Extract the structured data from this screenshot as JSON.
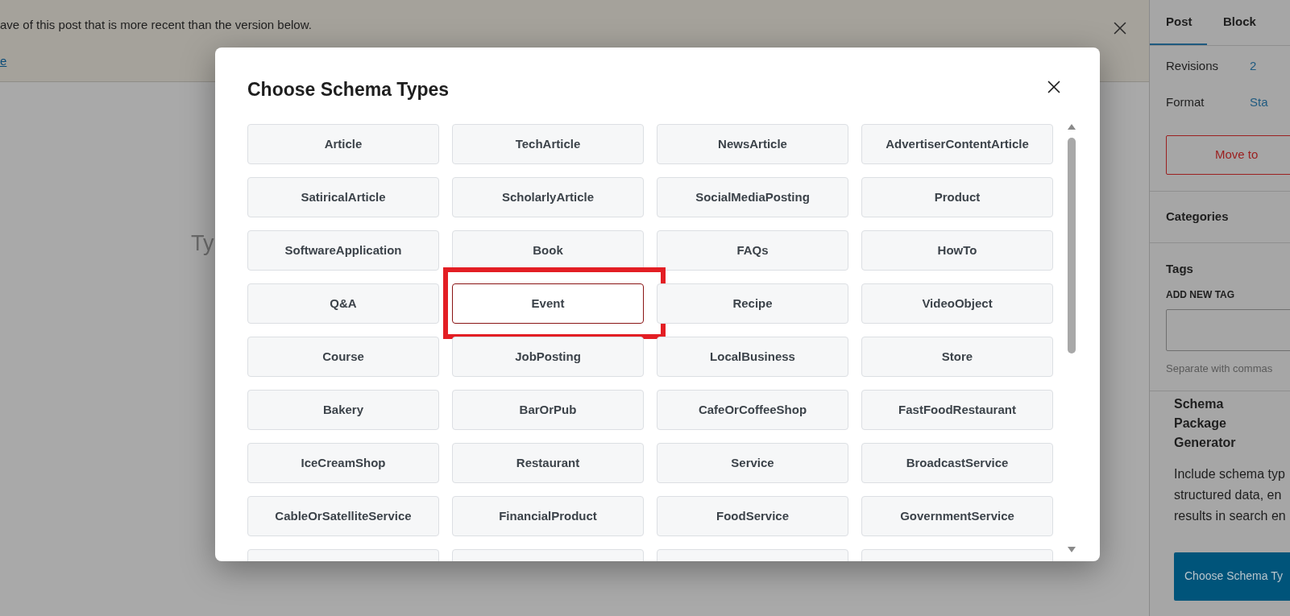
{
  "notice": {
    "message": "ave of this post that is more recent than the version below.",
    "link": "e"
  },
  "editor": {
    "placeholder": "Ty"
  },
  "sidebar": {
    "tabs": [
      {
        "label": "Post",
        "selected": true
      },
      {
        "label": "Block",
        "selected": false
      }
    ],
    "rows": [
      {
        "label": "Revisions",
        "value": "2"
      },
      {
        "label": "Format",
        "value": "Sta"
      }
    ],
    "trash_button": "Move to",
    "sections": [
      "Categories",
      "Tags"
    ],
    "tag_field_label": "ADD NEW TAG",
    "tag_hint": "Separate with commas",
    "schema_panel": {
      "title": "Schema Package Generator",
      "description_lines": [
        "Include schema typ",
        "structured data, en",
        "results in search en"
      ],
      "button": "Choose Schema Ty"
    }
  },
  "modal": {
    "title": "Choose Schema Types",
    "types": [
      {
        "label": "Article",
        "selected": false,
        "highlighted": false
      },
      {
        "label": "TechArticle",
        "selected": false,
        "highlighted": false
      },
      {
        "label": "NewsArticle",
        "selected": false,
        "highlighted": false
      },
      {
        "label": "AdvertiserContentArticle",
        "selected": false,
        "highlighted": false
      },
      {
        "label": "SatiricalArticle",
        "selected": false,
        "highlighted": false
      },
      {
        "label": "ScholarlyArticle",
        "selected": false,
        "highlighted": false
      },
      {
        "label": "SocialMediaPosting",
        "selected": false,
        "highlighted": false
      },
      {
        "label": "Product",
        "selected": false,
        "highlighted": false
      },
      {
        "label": "SoftwareApplication",
        "selected": false,
        "highlighted": false
      },
      {
        "label": "Book",
        "selected": false,
        "highlighted": false
      },
      {
        "label": "FAQs",
        "selected": false,
        "highlighted": false
      },
      {
        "label": "HowTo",
        "selected": false,
        "highlighted": false
      },
      {
        "label": "Q&A",
        "selected": false,
        "highlighted": false
      },
      {
        "label": "Event",
        "selected": true,
        "highlighted": true
      },
      {
        "label": "Recipe",
        "selected": false,
        "highlighted": false
      },
      {
        "label": "VideoObject",
        "selected": false,
        "highlighted": false
      },
      {
        "label": "Course",
        "selected": false,
        "highlighted": false
      },
      {
        "label": "JobPosting",
        "selected": false,
        "highlighted": false
      },
      {
        "label": "LocalBusiness",
        "selected": false,
        "highlighted": false
      },
      {
        "label": "Store",
        "selected": false,
        "highlighted": false
      },
      {
        "label": "Bakery",
        "selected": false,
        "highlighted": false
      },
      {
        "label": "BarOrPub",
        "selected": false,
        "highlighted": false
      },
      {
        "label": "CafeOrCoffeeShop",
        "selected": false,
        "highlighted": false
      },
      {
        "label": "FastFoodRestaurant",
        "selected": false,
        "highlighted": false
      },
      {
        "label": "IceCreamShop",
        "selected": false,
        "highlighted": false
      },
      {
        "label": "Restaurant",
        "selected": false,
        "highlighted": false
      },
      {
        "label": "Service",
        "selected": false,
        "highlighted": false
      },
      {
        "label": "BroadcastService",
        "selected": false,
        "highlighted": false
      },
      {
        "label": "CableOrSatelliteService",
        "selected": false,
        "highlighted": false
      },
      {
        "label": "FinancialProduct",
        "selected": false,
        "highlighted": false
      },
      {
        "label": "FoodService",
        "selected": false,
        "highlighted": false
      },
      {
        "label": "GovernmentService",
        "selected": false,
        "highlighted": false
      }
    ]
  }
}
